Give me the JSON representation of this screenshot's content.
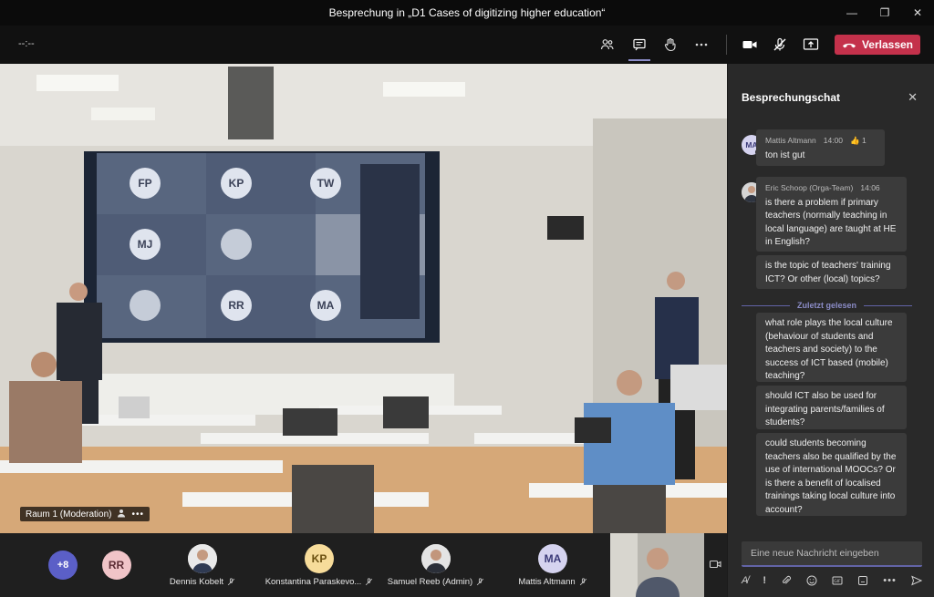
{
  "window": {
    "title": "Besprechung in „D1 Cases of digitizing higher education“"
  },
  "toolbar": {
    "timer": "--:--",
    "icons": [
      "participants-icon",
      "chat-icon",
      "raise-hand-icon",
      "more-icon",
      "camera-icon",
      "mic-off-icon",
      "share-icon"
    ],
    "leave_label": "Verlassen",
    "leave_color": "#c4314b"
  },
  "stage": {
    "room_label": "Raum 1 (Moderation)",
    "wall_initials": [
      "FP",
      "KP",
      "TW",
      "MJ",
      "",
      "",
      "",
      "RR",
      "MA"
    ]
  },
  "participants": {
    "overflow": "+8",
    "tiles": [
      {
        "name": "",
        "initials": "RR",
        "color": "#f0c4c8",
        "text_color": "#5b2c34"
      },
      {
        "name": "Dennis Kobelt",
        "initials": "",
        "color": "#d0d0d0"
      },
      {
        "name": "Konstantina Paraskevo...",
        "initials": "KP",
        "color": "#f7dc9a",
        "text_color": "#6b5010"
      },
      {
        "name": "Samuel Reeb (Admin)",
        "initials": "",
        "color": "#d0d0d0"
      },
      {
        "name": "Mattis Altmann",
        "initials": "MA",
        "color": "#d5d3ef",
        "text_color": "#3b3a78"
      }
    ]
  },
  "chat": {
    "title": "Besprechungschat",
    "messages": [
      {
        "initials": "MA",
        "author": "Mattis Altmann",
        "time": "14:00",
        "reaction": "1",
        "text": "ton ist gut"
      },
      {
        "author": "Eric Schoop (Orga-Team)",
        "time": "14:06",
        "text": "is there a problem if primary teachers (normally teaching in local language) are taught at HE in English?"
      },
      {
        "text": "is the topic of teachers' training ICT? Or other (local) topics?"
      },
      {
        "text": "what role plays the local culture (behaviour of students and teachers and society) to the success of ICT based (mobile) teaching?"
      },
      {
        "text": "should ICT also be used for integrating parents/families of students?"
      },
      {
        "text": "could students becoming teachers also be qualified by the use of international MOOCs? Or is there a benefit of localised trainings taking local culture into account?"
      }
    ],
    "last_read_label": "Zuletzt gelesen",
    "compose_placeholder": "Eine neue Nachricht eingeben",
    "accent": "#6264a7"
  }
}
